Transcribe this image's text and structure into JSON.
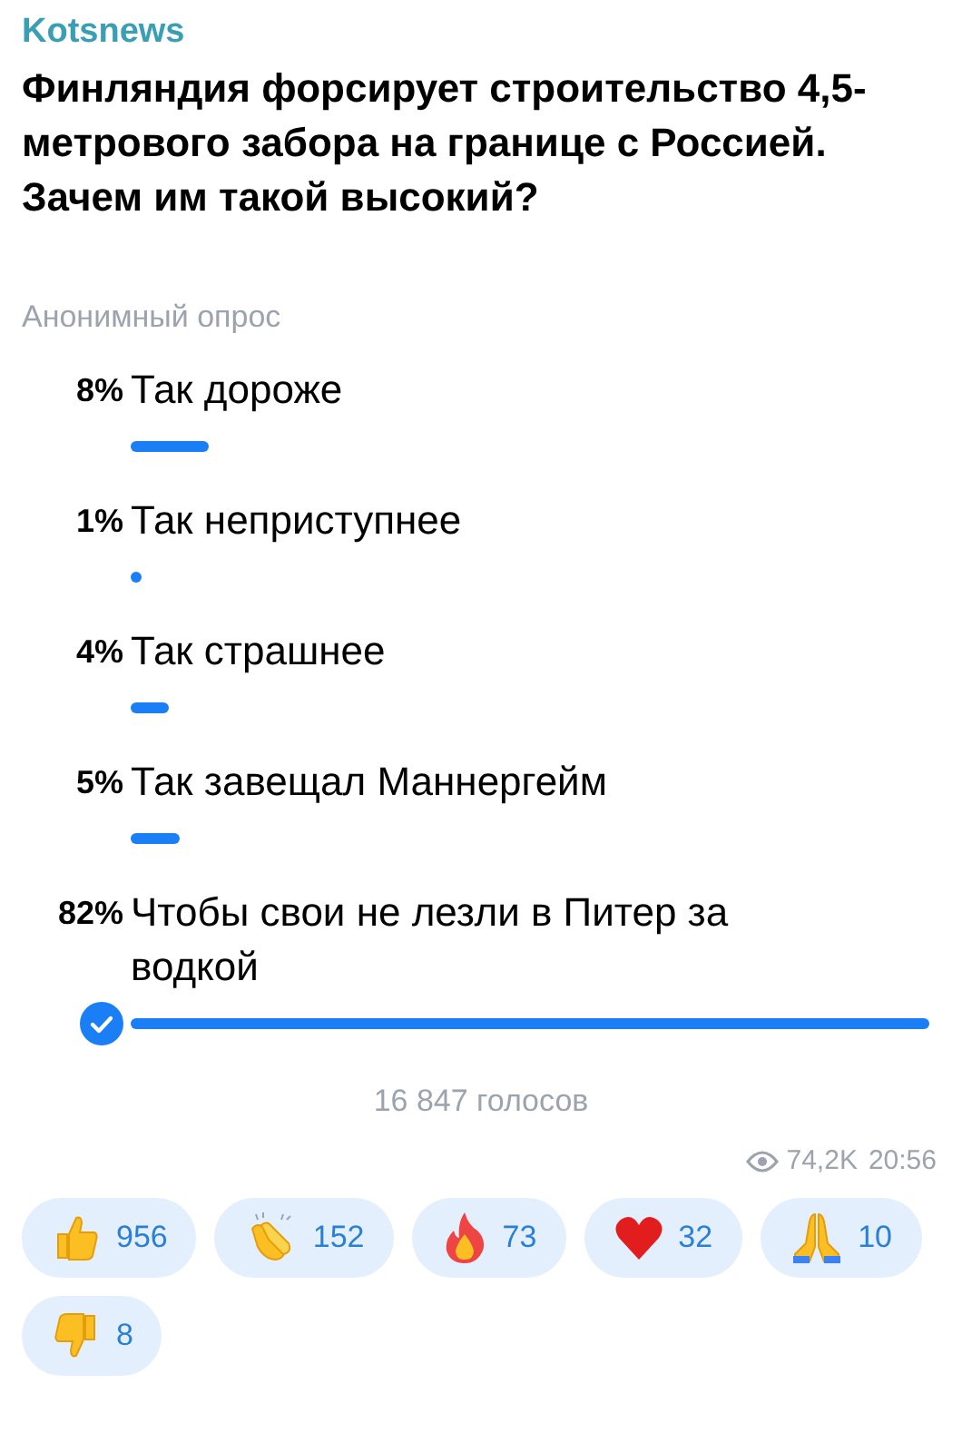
{
  "channel": "Kotsnews",
  "title": "Финляндия форсирует строительство 4,5-метрового забора на границе с Россией. Зачем им такой высокий?",
  "poll_type": "Анонимный опрос",
  "options": [
    {
      "percent": "8%",
      "label": "Так дороже",
      "selected": false
    },
    {
      "percent": "1%",
      "label": "Так неприступнее",
      "selected": false
    },
    {
      "percent": "4%",
      "label": "Так страшнее",
      "selected": false
    },
    {
      "percent": "5%",
      "label": "Так завещал Маннергейм",
      "selected": false
    },
    {
      "percent": "82%",
      "label": "Чтобы свои не лезли в Питер за водкой",
      "selected": true
    }
  ],
  "votes": "16 847 голосов",
  "views": "74,2K",
  "time": "20:56",
  "reactions": [
    {
      "kind": "thumbs-up",
      "count": "956"
    },
    {
      "kind": "clap",
      "count": "152"
    },
    {
      "kind": "fire",
      "count": "73"
    },
    {
      "kind": "heart",
      "count": "32"
    },
    {
      "kind": "pray",
      "count": "10"
    },
    {
      "kind": "thumbs-down",
      "count": "8"
    }
  ]
}
